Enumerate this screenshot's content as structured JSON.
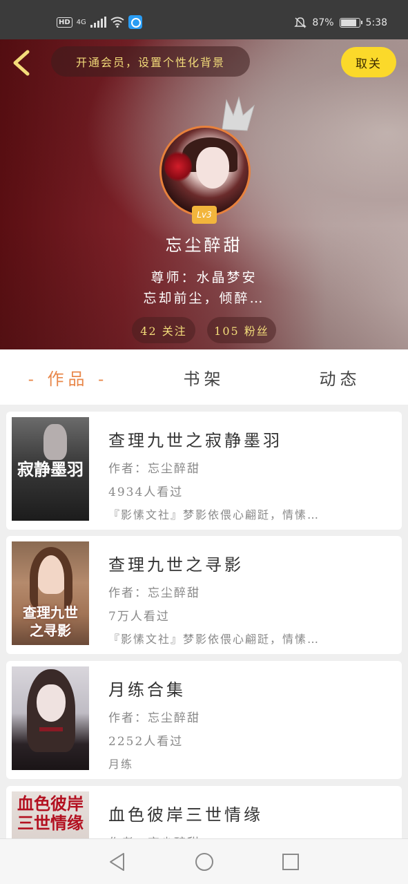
{
  "status_bar": {
    "hd": "HD",
    "network": "4G",
    "battery_pct": "87%",
    "battery_level": 0.87,
    "time": "5:38",
    "icons": [
      "hd-icon",
      "signal-icon",
      "wifi-icon",
      "app-notification-icon",
      "mute-bell-icon",
      "battery-icon"
    ]
  },
  "header": {
    "vip_text": "开通会员，设置个性化背景",
    "follow_btn": "取关"
  },
  "profile": {
    "level": "Lv3",
    "username": "忘尘醉甜",
    "teacher": "尊师：水晶梦安",
    "bio": "忘却前尘，倾醉…",
    "following": "42 关注",
    "fans": "105 粉丝"
  },
  "tabs": [
    {
      "label": "- 作品 -",
      "active": true
    },
    {
      "label": "书架",
      "active": false
    },
    {
      "label": "动态",
      "active": false
    }
  ],
  "works": [
    {
      "title": "查理九世之寂静墨羽",
      "author": "作者：忘尘醉甜",
      "views": "4934人看过",
      "desc": "『影愫文社』梦影依偎心翩跹，情愫…",
      "cover_text": "寂静墨羽"
    },
    {
      "title": "查理九世之寻影",
      "author": "作者：忘尘醉甜",
      "views": "7万人看过",
      "desc": "『影愫文社』梦影依偎心翩跹，情愫…",
      "cover_text": "查理九世之寻影"
    },
    {
      "title": "月练合集",
      "author": "作者：忘尘醉甜",
      "views": "2252人看过",
      "desc": "月练",
      "cover_text": ""
    },
    {
      "title": "血色彼岸三世情缘",
      "author": "作者：忘尘醉甜",
      "views": "",
      "desc": "",
      "cover_text": "血色彼岸三世情缘"
    }
  ],
  "colors": {
    "accent": "#e8874a",
    "follow_btn": "#fbd92a",
    "vip_text": "#f3dc7a",
    "level_badge": "#f2b53c"
  }
}
